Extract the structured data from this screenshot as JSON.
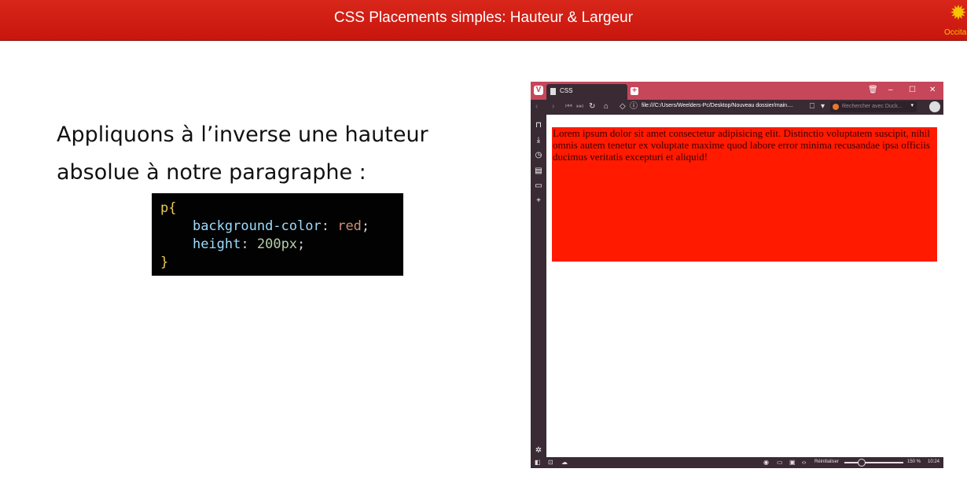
{
  "header": {
    "title": "CSS Placements simples: Hauteur & Largeur",
    "logo_text": "Occitanie"
  },
  "slide": {
    "heading_line1": "Appliquons à l’inverse une hauteur",
    "heading_line2": "absolue à notre paragraphe :"
  },
  "code": {
    "selector": "p{",
    "prop1": "background-color",
    "val1": "red",
    "prop2": "height",
    "val2": "200px",
    "close": "}"
  },
  "browser": {
    "tab_label": "CSS",
    "url": "file:///C:/Users/Weelders-Pc/Desktop/Nouveau dossier/main....",
    "search_placeholder": "Rechercher avec Duck...",
    "paragraph": "Lorem ipsum dolor sit amet consectetur adipisicing elit. Distinctio voluptatem suscipit, nihil omnis autem tenetur ex voluptate maxime quod labore error minima recusandae ipsa officiis ducimus veritatis excepturi et aliquid!",
    "reset_label": "Réinitialiser",
    "zoom": "150 %",
    "time": "10:24"
  }
}
